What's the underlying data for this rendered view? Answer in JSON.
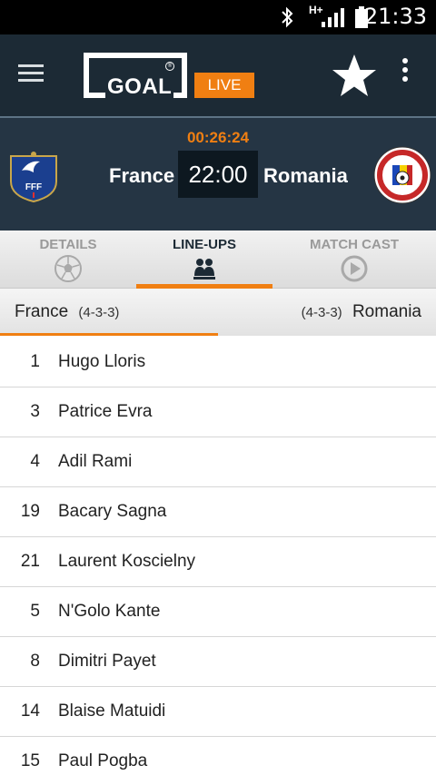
{
  "status_bar": {
    "time": "21:33",
    "network": "H+"
  },
  "app_bar": {
    "logo_text": "GOAL",
    "live_badge": "LIVE",
    "menu_icon": "hamburger-menu-icon",
    "favorite_icon": "star-icon",
    "more_icon": "more-vertical-icon"
  },
  "match": {
    "clock": "00:26:24",
    "home_team": "France",
    "away_team": "Romania",
    "kickoff": "22:00"
  },
  "tabs": [
    {
      "label": "DETAILS",
      "icon": "soccer-ball-icon",
      "active": false
    },
    {
      "label": "LINE-UPS",
      "icon": "players-icon",
      "active": true
    },
    {
      "label": "MATCH CAST",
      "icon": "play-circle-icon",
      "active": false
    }
  ],
  "formation": {
    "home_team": "France",
    "home_formation": "(4-3-3)",
    "away_formation": "(4-3-3)",
    "away_team": "Romania"
  },
  "players": [
    {
      "number": "1",
      "name": "Hugo Lloris"
    },
    {
      "number": "3",
      "name": "Patrice Evra"
    },
    {
      "number": "4",
      "name": "Adil Rami"
    },
    {
      "number": "19",
      "name": "Bacary Sagna"
    },
    {
      "number": "21",
      "name": "Laurent Koscielny"
    },
    {
      "number": "5",
      "name": "N'Golo Kante"
    },
    {
      "number": "8",
      "name": "Dimitri Payet"
    },
    {
      "number": "14",
      "name": "Blaise Matuidi"
    },
    {
      "number": "15",
      "name": "Paul Pogba"
    }
  ],
  "colors": {
    "accent": "#f07f12",
    "header_bg": "#1c2a35",
    "match_bg": "#253544"
  }
}
